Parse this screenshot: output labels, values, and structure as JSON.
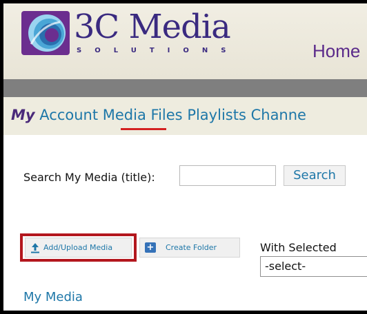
{
  "header": {
    "brand_title": "3C Media",
    "brand_subtitle": "SOLUTIONS",
    "home_link": "Home"
  },
  "nav": {
    "my": "My",
    "account": "Account",
    "media": "Media",
    "files": "Files",
    "playlists": "Playlists",
    "channels": "Channe"
  },
  "search": {
    "label": "Search My Media (title):",
    "value": "",
    "button_label": "Search"
  },
  "toolbar": {
    "upload_label": "Add/Upload Media",
    "folder_label": "Create Folder",
    "with_selected_label": "With Selected",
    "select_value": "-select-"
  },
  "section": {
    "heading": "My Media"
  },
  "colors": {
    "highlight_border": "#b3171e",
    "link": "#1e77a8",
    "brand": "#3a2a80"
  },
  "icons": {
    "logo": "swirl-logo-icon",
    "upload": "upload-arrow-icon",
    "folder": "add-folder-icon"
  }
}
